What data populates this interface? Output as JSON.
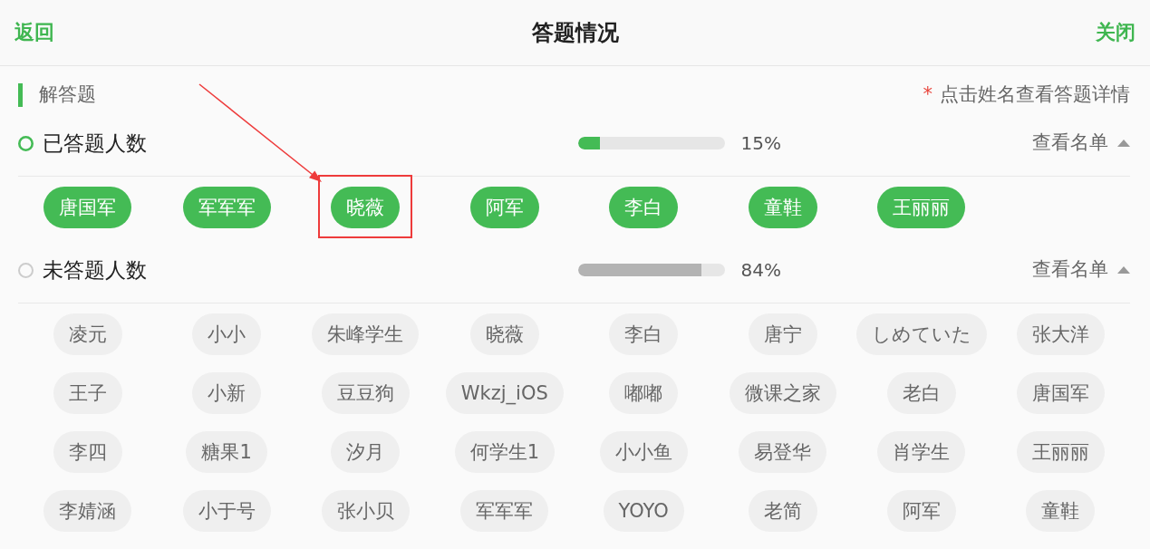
{
  "header": {
    "back": "返回",
    "title": "答题情况",
    "close": "关闭"
  },
  "section": {
    "title": "解答题",
    "hint_mark": "*",
    "hint": "点击姓名查看答题详情"
  },
  "groups": [
    {
      "kind": "answered",
      "label": "已答题人数",
      "level": 0.15,
      "reading": "15%",
      "toggle": "查看名单",
      "expanded": true,
      "names": [
        {
          "name": "唐国军",
          "highlighted": false
        },
        {
          "name": "军军军",
          "highlighted": false
        },
        {
          "name": "晓薇",
          "highlighted": true
        },
        {
          "name": "阿军",
          "highlighted": false
        },
        {
          "name": "李白",
          "highlighted": false
        },
        {
          "name": "童鞋",
          "highlighted": false
        },
        {
          "name": "王丽丽",
          "highlighted": false
        }
      ]
    },
    {
      "kind": "unanswered",
      "label": "未答题人数",
      "level": 0.84,
      "reading": "84%",
      "toggle": "查看名单",
      "expanded": true,
      "names": [
        {
          "name": "凌元",
          "highlighted": false
        },
        {
          "name": "小小",
          "highlighted": false
        },
        {
          "name": "朱峰学生",
          "highlighted": false
        },
        {
          "name": "晓薇",
          "highlighted": false
        },
        {
          "name": "李白",
          "highlighted": false
        },
        {
          "name": "唐宁",
          "highlighted": false
        },
        {
          "name": "しめていた",
          "highlighted": false
        },
        {
          "name": "张大洋",
          "highlighted": false
        },
        {
          "name": "王子",
          "highlighted": false
        },
        {
          "name": "小新",
          "highlighted": false
        },
        {
          "name": "豆豆狗",
          "highlighted": false
        },
        {
          "name": "Wkzj_iOS",
          "highlighted": false
        },
        {
          "name": "嘟嘟",
          "highlighted": false
        },
        {
          "name": "微课之家",
          "highlighted": false
        },
        {
          "name": "老白",
          "highlighted": false
        },
        {
          "name": "唐国军",
          "highlighted": false
        },
        {
          "name": "李四",
          "highlighted": false
        },
        {
          "name": "糖果1",
          "highlighted": false
        },
        {
          "name": "汐月",
          "highlighted": false
        },
        {
          "name": "何学生1",
          "highlighted": false
        },
        {
          "name": "小小鱼",
          "highlighted": false
        },
        {
          "name": "易登华",
          "highlighted": false
        },
        {
          "name": "肖学生",
          "highlighted": false
        },
        {
          "name": "王丽丽",
          "highlighted": false
        },
        {
          "name": "李婧涵",
          "highlighted": false
        },
        {
          "name": "小于号",
          "highlighted": false
        },
        {
          "name": "张小贝",
          "highlighted": false
        },
        {
          "name": "军军军",
          "highlighted": false
        },
        {
          "name": "YOYO",
          "highlighted": false
        },
        {
          "name": "老简",
          "highlighted": false
        },
        {
          "name": "阿军",
          "highlighted": false
        },
        {
          "name": "童鞋",
          "highlighted": false
        }
      ]
    }
  ]
}
